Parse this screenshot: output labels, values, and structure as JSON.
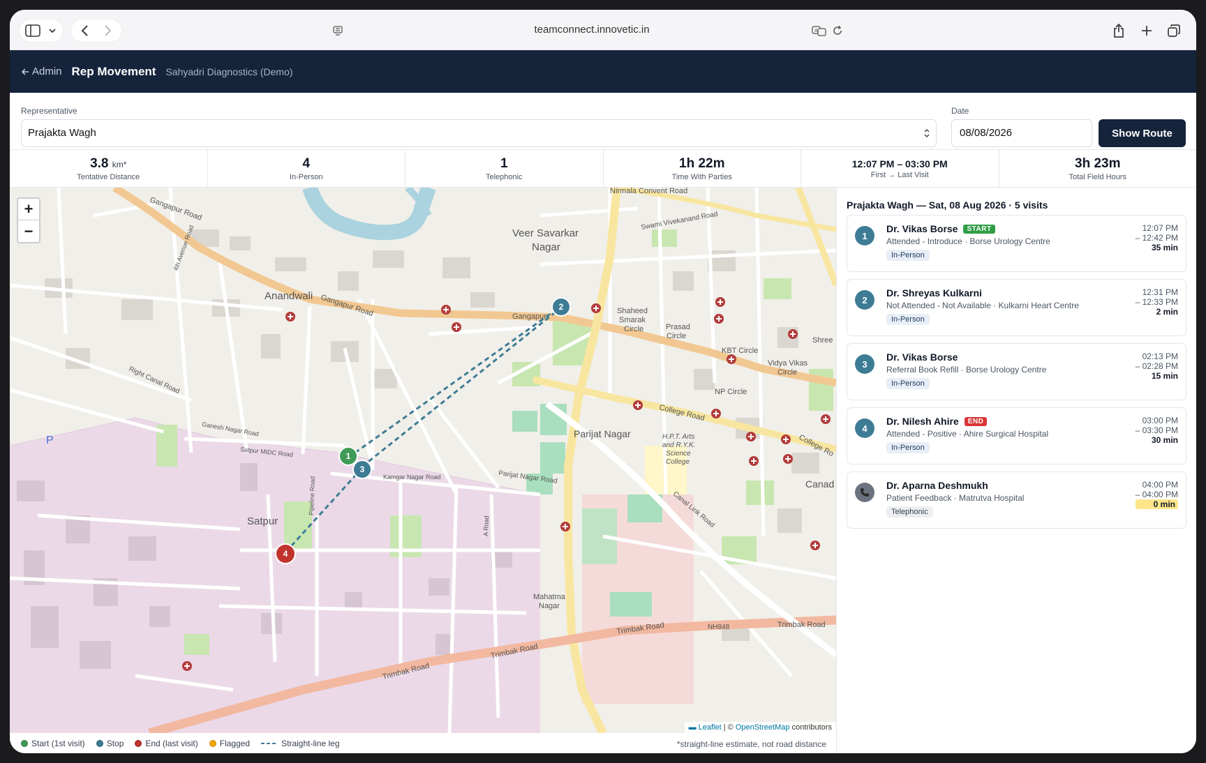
{
  "browser": {
    "url": "teamconnect.innovetic.in",
    "icons": [
      "sidebar-icon",
      "chevron-down-icon",
      "back-icon",
      "forward-icon",
      "reader-icon",
      "translate-icon",
      "reload-icon",
      "share-icon",
      "new-tab-icon",
      "tabs-icon"
    ]
  },
  "header": {
    "back_label": "Admin",
    "title": "Rep Movement",
    "org": "Sahyadri Diagnostics (Demo)"
  },
  "filters": {
    "rep_label": "Representative",
    "rep_value": "Prajakta Wagh",
    "date_label": "Date",
    "date_value": "08/08/2026",
    "show_route": "Show Route"
  },
  "stats": [
    {
      "value": "3.8",
      "unit": "km*",
      "label": "Tentative Distance"
    },
    {
      "value": "4",
      "unit": "",
      "label": "In-Person"
    },
    {
      "value": "1",
      "unit": "",
      "label": "Telephonic"
    },
    {
      "value": "1h 22m",
      "unit": "",
      "label": "Time With Parties"
    },
    {
      "value": "12:07 PM – 03:30 PM",
      "unit": "",
      "label": "First → Last Visit"
    },
    {
      "value": "3h 23m",
      "unit": "",
      "label": "Total Field Hours"
    }
  ],
  "map": {
    "zoom_in": "+",
    "zoom_out": "−",
    "attribution_leaflet": "Leaflet",
    "attribution_sep": " | © ",
    "attribution_osm": "OpenStreetMap",
    "attribution_tail": " contributors",
    "labels": {
      "veer": "Veer Savarkar",
      "nagar": "Nagar",
      "anandwali": "Anandwali",
      "gangapur_road": "Gangapur Road",
      "gangapur": "Gangapur",
      "nirmala": "Nirmala Convent Road",
      "vivekanand": "Swami Vivekanand Road",
      "shaheed1": "Shaheed",
      "shaheed2": "Smarak",
      "shaheed3": "Circle",
      "prasad1": "Prasad",
      "prasad2": "Circle",
      "kbt": "KBT Circle",
      "vidya1": "Vidya Vikas",
      "vidya2": "Circle",
      "np": "NP Circle",
      "college": "College Road",
      "college2": "College Ro",
      "parijat": "Parijat Nagar",
      "parijat_road": "Parijat Nagar Road",
      "hpt1": "H.P.T. Arts",
      "hpt2": "and R.Y.K.",
      "hpt3": "Science",
      "hpt4": "College",
      "satpur": "Satpur",
      "satpur_midc": "Satpur MIDC Road",
      "ganesh": "Ganesh Nagar Road",
      "right_canal": "Right Canal Road",
      "kamgar": "Kamgar Nagar Road",
      "mahatma1": "Mahatma",
      "mahatma2": "Nagar",
      "trimbak1": "Trimbak Road",
      "trimbak2": "Trimbak Road",
      "trimbak3": "Trimbak Road",
      "trimbak4": "Trimbak Road",
      "nh848": "NH848",
      "canal_link": "Canal Link Road",
      "canad": "Canad",
      "shree": "Shree",
      "ave4": "4th Avenue Road",
      "pipeline": "Pipeline Road",
      "a_road": "A Road",
      "gangapur_top": "Gangapur Road",
      "p": "P"
    },
    "markers": [
      {
        "num": "1",
        "color": "#3f9b55"
      },
      {
        "num": "2",
        "color": "#3e7c95"
      },
      {
        "num": "3",
        "color": "#3e7c95"
      },
      {
        "num": "4",
        "color": "#c0342d"
      }
    ]
  },
  "legend": {
    "start": "Start (1st visit)",
    "stop": "Stop",
    "end": "End (last visit)",
    "flagged": "Flagged",
    "leg": "Straight-line leg",
    "note": "*straight-line estimate, not road distance",
    "colors": {
      "start": "#3f9b55",
      "stop": "#3e7c95",
      "end": "#c0342d",
      "flagged": "#f0a500"
    }
  },
  "panel": {
    "title": "Prajakta Wagh — Sat, 08 Aug 2026 · 5 visits",
    "visits": [
      {
        "num": "1",
        "name": "Dr. Vikas Borse",
        "tag": "START",
        "tag_color": "#2f9e44",
        "sub": "Attended - Introduce · Borse Urology Centre",
        "type": "In-Person",
        "t1": "12:07 PM",
        "t2": "– 12:42 PM",
        "dur": "35 min"
      },
      {
        "num": "2",
        "name": "Dr. Shreyas Kulkarni",
        "tag": "",
        "tag_color": "",
        "sub": "Not Attended - Not Available · Kulkarni Heart Centre",
        "type": "In-Person",
        "t1": "12:31 PM",
        "t2": "– 12:33 PM",
        "dur": "2 min"
      },
      {
        "num": "3",
        "name": "Dr. Vikas Borse",
        "tag": "",
        "tag_color": "",
        "sub": "Referral Book Refill · Borse Urology Centre",
        "type": "In-Person",
        "t1": "02:13 PM",
        "t2": "– 02:28 PM",
        "dur": "15 min"
      },
      {
        "num": "4",
        "name": "Dr. Nilesh Ahire",
        "tag": "END",
        "tag_color": "#d93636",
        "sub": "Attended - Positive · Ahire Surgical Hospital",
        "type": "In-Person",
        "t1": "03:00 PM",
        "t2": "– 03:30 PM",
        "dur": "30 min"
      },
      {
        "num": "📞",
        "name": "Dr. Aparna Deshmukh",
        "tag": "",
        "tag_color": "",
        "sub": "Patient Feedback · Matrutva Hospital",
        "type": "Telephonic",
        "t1": "04:00 PM",
        "t2": "– 04:00 PM",
        "dur": "0 min"
      }
    ]
  }
}
